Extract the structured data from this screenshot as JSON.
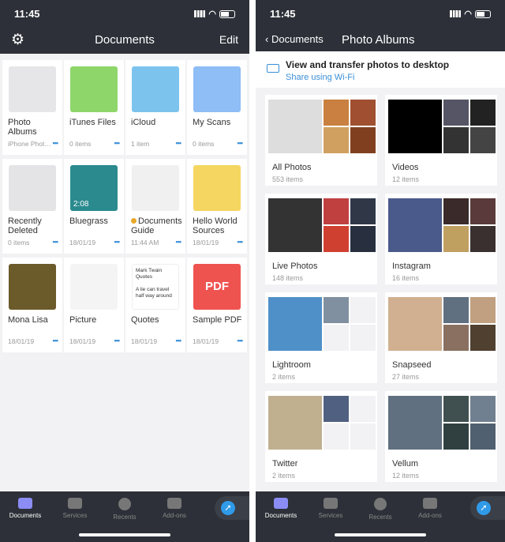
{
  "status": {
    "time": "11:45"
  },
  "left": {
    "title": "Documents",
    "edit": "Edit",
    "settings_icon": "gear-icon",
    "items": [
      {
        "name": "Photo Albums",
        "sub": "iPhone Phot…",
        "color": "#e6e6e8"
      },
      {
        "name": "iTunes Files",
        "sub": "0 items",
        "color": "#8ed66a"
      },
      {
        "name": "iCloud",
        "sub": "1 item",
        "color": "#7cc4ee"
      },
      {
        "name": "My Scans",
        "sub": "0 items",
        "color": "#8fbdf5"
      },
      {
        "name": "Recently Deleted",
        "sub": "0 items",
        "color": "#e4e4e6"
      },
      {
        "name": "Bluegrass",
        "sub": "18/01/19",
        "color": "#2a8a8e",
        "duration": "2:08"
      },
      {
        "name": "Documents Guide",
        "sub": "11:44 AM",
        "color": "#f0f0f0",
        "badge": "#e8a82a"
      },
      {
        "name": "Hello World Sources",
        "sub": "18/01/19",
        "color": "#f4d660"
      },
      {
        "name": "Mona Lisa",
        "sub": "18/01/19",
        "color": "#6b5a2a"
      },
      {
        "name": "Picture",
        "sub": "18/01/19",
        "color": "#f4f4f4"
      },
      {
        "name": "Quotes",
        "sub": "18/01/19",
        "color": "#ffffff",
        "preview": [
          "Mark Twain Quotes",
          "A lie can travel half way around"
        ]
      },
      {
        "name": "Sample PDF",
        "sub": "18/01/19",
        "color": "#ef5350",
        "label": "PDF"
      }
    ]
  },
  "right": {
    "back": "Documents",
    "title": "Photo Albums",
    "banner": {
      "title": "View and transfer photos to desktop",
      "link": "Share using Wi-Fi"
    },
    "albums": [
      {
        "name": "All Photos",
        "count": "553 items",
        "colors": [
          "#ddd",
          "#c98040",
          "#a05030",
          "#d0a060",
          "#804020"
        ]
      },
      {
        "name": "Videos",
        "count": "12 items",
        "colors": [
          "#000",
          "#556",
          "#222",
          "#333",
          "#444"
        ]
      },
      {
        "name": "Live Photos",
        "count": "148 items",
        "colors": [
          "#333",
          "#c04040",
          "#303848",
          "#d04030",
          "#283040"
        ]
      },
      {
        "name": "Instagram",
        "count": "16 items",
        "colors": [
          "#4a5a8a",
          "#3a2a2a",
          "#5a3a3a",
          "#c0a060",
          "#3a3030"
        ]
      },
      {
        "name": "Lightroom",
        "count": "2 items",
        "colors": [
          "#5090c8",
          "#8090a0",
          "#f2f2f4",
          "#f2f2f4",
          "#f2f2f4"
        ]
      },
      {
        "name": "Snapseed",
        "count": "27 items",
        "colors": [
          "#d0b090",
          "#607080",
          "#c0a080",
          "#8a7060",
          "#504030"
        ]
      },
      {
        "name": "Twitter",
        "count": "2 items",
        "colors": [
          "#c0b090",
          "#506080",
          "#f2f2f4",
          "#f2f2f4",
          "#f2f2f4"
        ]
      },
      {
        "name": "Vellum",
        "count": "12 items",
        "colors": [
          "#607080",
          "#405050",
          "#708090",
          "#304040",
          "#506070"
        ]
      }
    ]
  },
  "tabs": [
    "Documents",
    "Services",
    "Recents",
    "Add-ons"
  ],
  "colors": {
    "accent": "#3a8fd8",
    "active_tab": "#8b8df5",
    "bar": "#2d3038"
  }
}
